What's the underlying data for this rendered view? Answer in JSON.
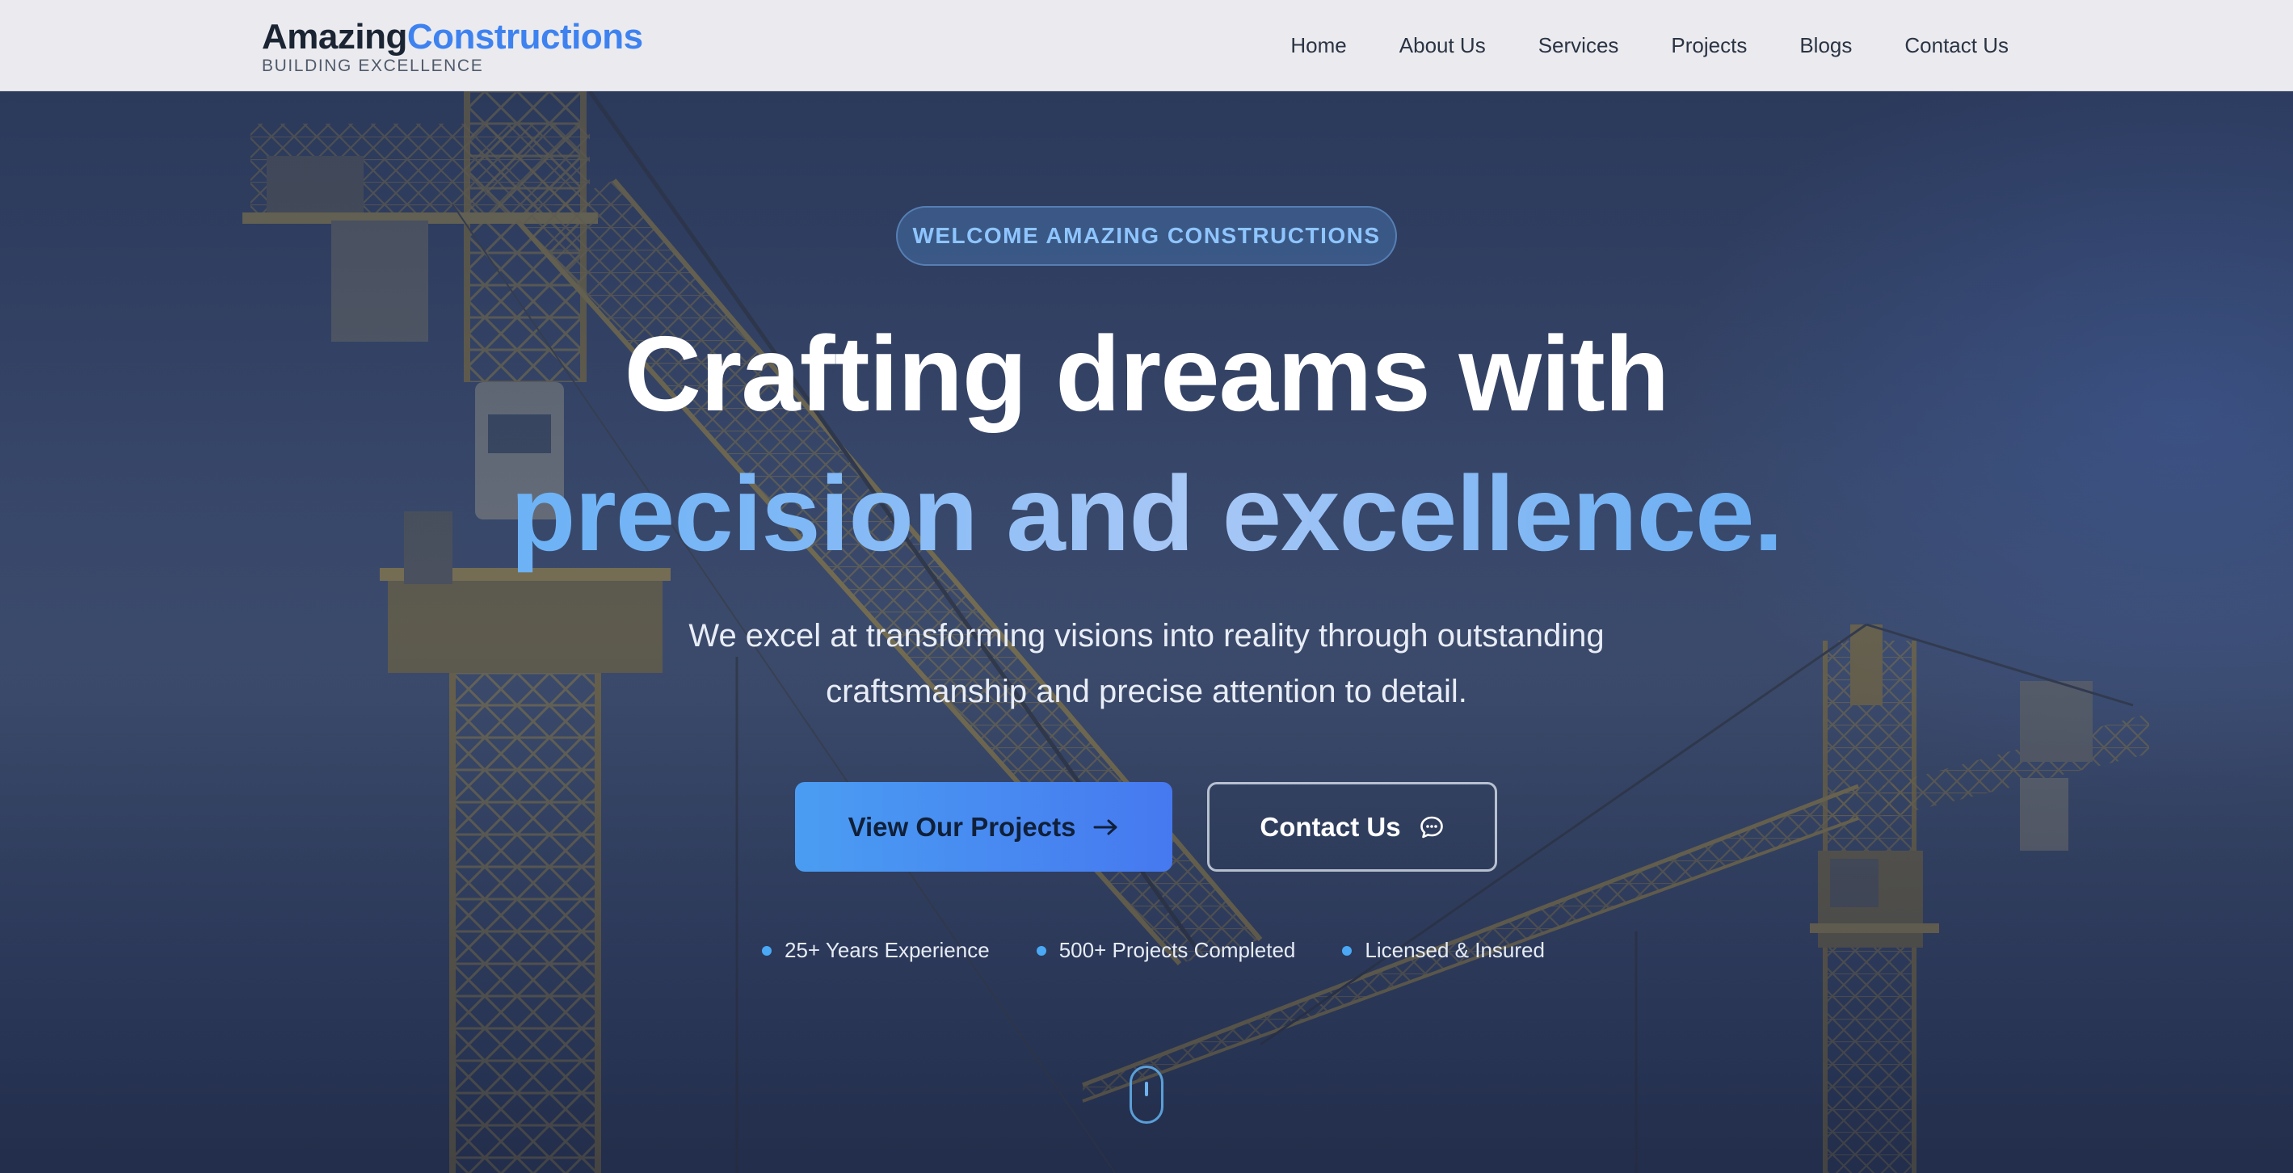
{
  "brand": {
    "name_part1": "Amazing",
    "name_part2": "Constructions",
    "tagline": "BUILDING EXCELLENCE"
  },
  "nav": {
    "items": [
      "Home",
      "About Us",
      "Services",
      "Projects",
      "Blogs",
      "Contact Us"
    ]
  },
  "hero": {
    "badge": "WELCOME AMAZING CONSTRUCTIONS",
    "headline_line1": "Crafting dreams with",
    "headline_line2": "precision and excellence.",
    "subtext": "We excel at transforming visions into reality through outstanding craftsmanship and precise attention to detail.",
    "primary_cta": "View Our Projects",
    "secondary_cta": "Contact Us",
    "stats": [
      "25+ Years Experience",
      "500+ Projects Completed",
      "Licensed & Insured"
    ]
  },
  "icons": {
    "primary_cta_icon": "arrow-right-icon",
    "secondary_cta_icon": "chat-bubble-icon",
    "scroll_indicator": "mouse-scroll-icon"
  },
  "colors": {
    "accent": "#3e82f0",
    "header_bg": "#ebebef",
    "hero_bg": "#3a4a6c",
    "badge_text": "#8ec5ff",
    "stat_dot": "#4aa8f4"
  }
}
